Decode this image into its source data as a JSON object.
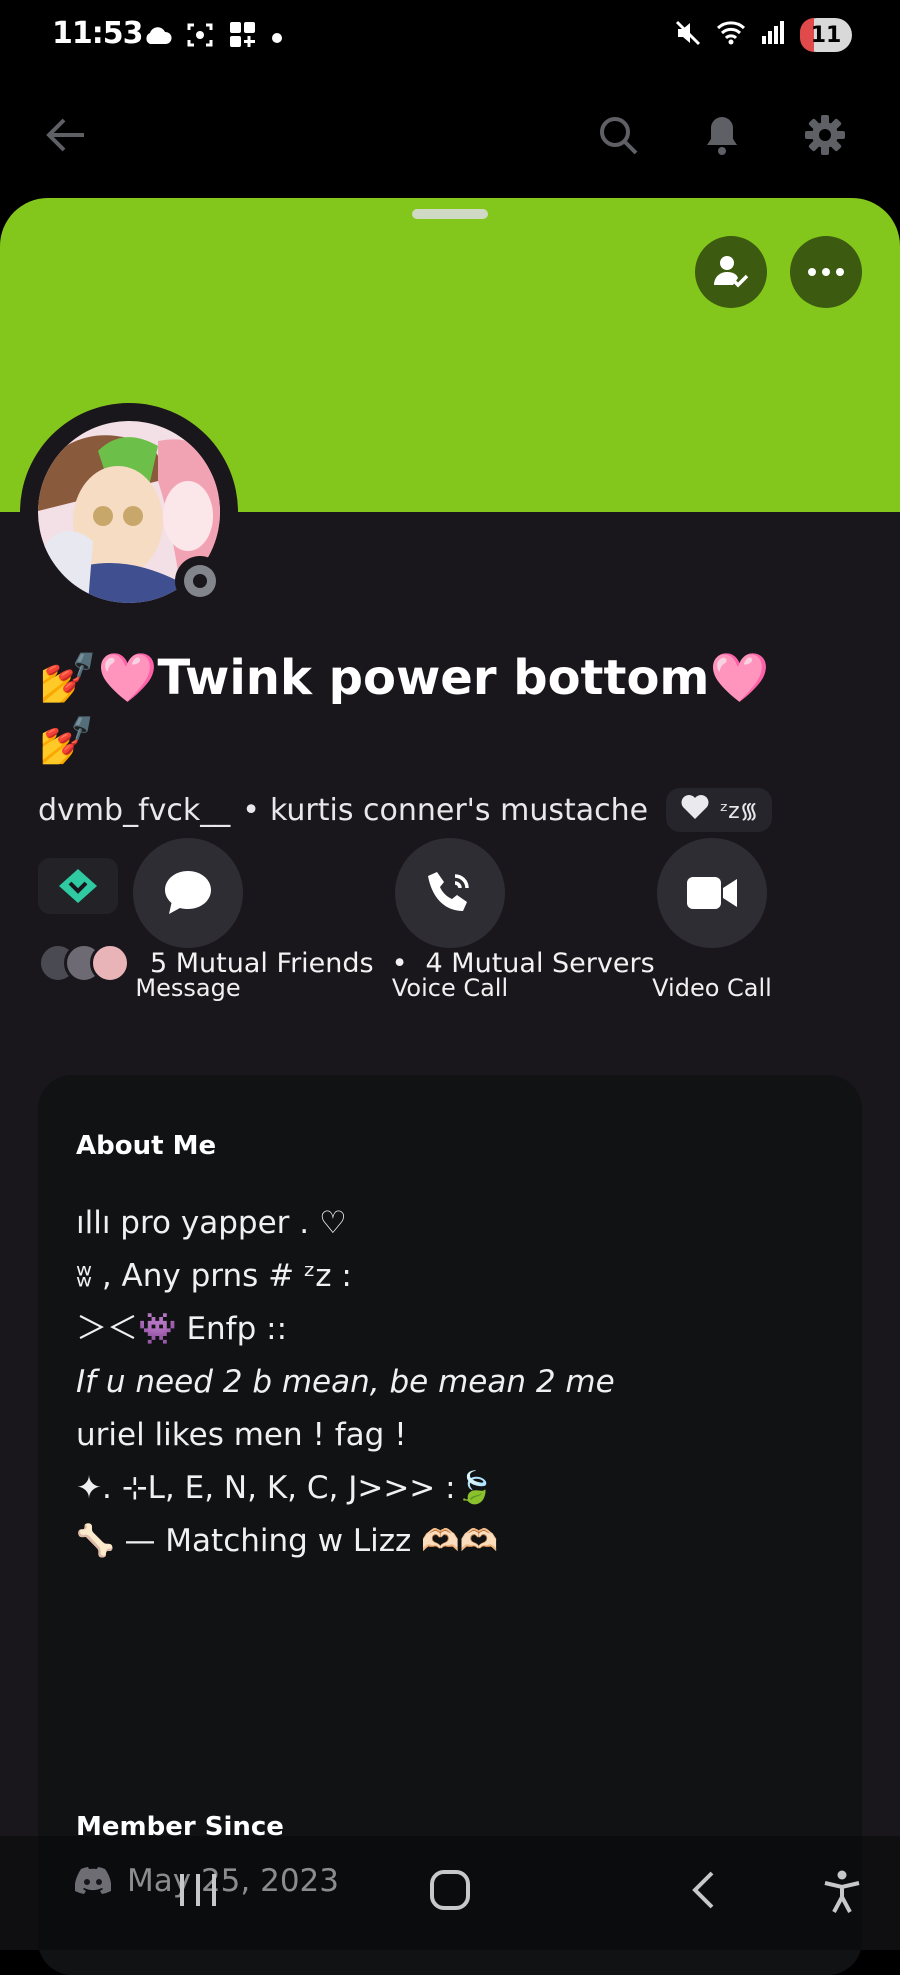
{
  "status_bar": {
    "time": "11:53",
    "battery": "11"
  },
  "profile": {
    "display_name": "💅🩷Twink power bottom🩷",
    "display_name_line2": "💅",
    "username": "dvmb_fvck__",
    "separator": "•",
    "pronouns": "kurtis conner's mustache",
    "status_pill_text": "ᶻz᯾",
    "banner_color": "#84c71c",
    "mutuals": {
      "friends": "5 Mutual Friends",
      "separator": "•",
      "servers": "4 Mutual Servers"
    }
  },
  "actions": [
    {
      "label": "Message",
      "icon": "chat-bubble-icon"
    },
    {
      "label": "Voice Call",
      "icon": "phone-icon"
    },
    {
      "label": "Video Call",
      "icon": "video-camera-icon"
    }
  ],
  "about": {
    "heading": "About Me",
    "lines": [
      "ıllı pro yapper   .  ♡",
      "ʬ ,  Any prns # ᶻz  :",
      "＞＜👾 Enfp ::",
      "If u need 2 b mean, be mean 2 me",
      "uriel likes men ! fag !",
      "✦. ⊹L, E, N, K, C, J>>> :🍃",
      "🦴 — Matching w Lizz 🫶🏻🫶🏻"
    ],
    "member_since_heading": "Member Since",
    "member_since_date": "May 25, 2023"
  }
}
